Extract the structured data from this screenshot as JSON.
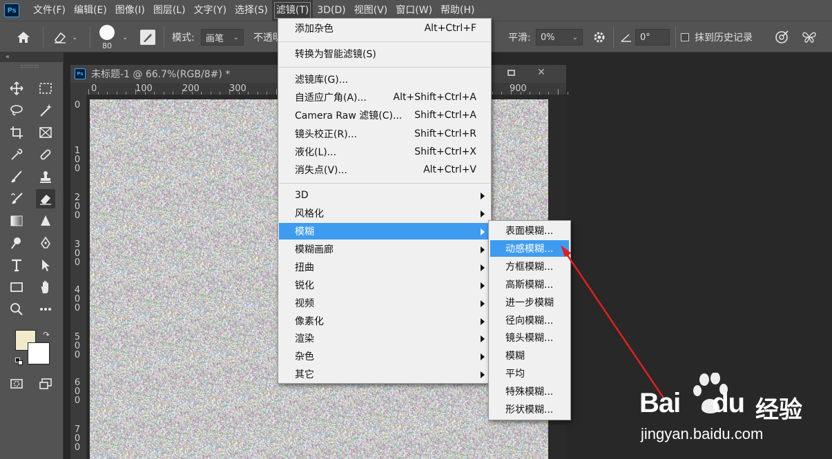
{
  "app": {
    "logo": "Ps"
  },
  "menubar": {
    "items": [
      "文件(F)",
      "编辑(E)",
      "图像(I)",
      "图层(L)",
      "文字(Y)",
      "选择(S)",
      "滤镜(T)",
      "3D(D)",
      "视图(V)",
      "窗口(W)",
      "帮助(H)"
    ],
    "active_index": 6
  },
  "options": {
    "brush_size": "80",
    "mode_label": "模式:",
    "mode_value": "画笔",
    "opacity_label": "不透明",
    "smooth_label": "平滑:",
    "smooth_value": "0%",
    "angle_value": "0°",
    "history_label": "抹到历史记录"
  },
  "document": {
    "title": "未标题-1 @ 66.7%(RGB/8#) *",
    "ruler_top": [
      "0",
      "100",
      "200",
      "300",
      "900"
    ],
    "ruler_left": [
      "0",
      "1\n0\n0",
      "2\n0\n0",
      "3\n0\n0",
      "4\n0\n0",
      "5\n0\n0",
      "6\n0\n0",
      "7\n0\n0"
    ],
    "canvas_texture": "noise"
  },
  "filter_menu": {
    "group1": [
      {
        "label": "添加杂色",
        "shortcut": "Alt+Ctrl+F"
      }
    ],
    "group2": [
      {
        "label": "转换为智能滤镜(S)",
        "shortcut": ""
      }
    ],
    "group3": [
      {
        "label": "滤镜库(G)...",
        "shortcut": ""
      },
      {
        "label": "自适应广角(A)...",
        "shortcut": "Alt+Shift+Ctrl+A"
      },
      {
        "label": "Camera Raw 滤镜(C)...",
        "shortcut": "Shift+Ctrl+A"
      },
      {
        "label": "镜头校正(R)...",
        "shortcut": "Shift+Ctrl+R"
      },
      {
        "label": "液化(L)...",
        "shortcut": "Shift+Ctrl+X"
      },
      {
        "label": "消失点(V)...",
        "shortcut": "Alt+Ctrl+V"
      }
    ],
    "group4": [
      {
        "label": "3D"
      },
      {
        "label": "风格化"
      },
      {
        "label": "模糊"
      },
      {
        "label": "模糊画廊"
      },
      {
        "label": "扭曲"
      },
      {
        "label": "锐化"
      },
      {
        "label": "视频"
      },
      {
        "label": "像素化"
      },
      {
        "label": "渲染"
      },
      {
        "label": "杂色"
      },
      {
        "label": "其它"
      }
    ],
    "highlighted": "模糊"
  },
  "blur_submenu": {
    "items": [
      "表面模糊...",
      "动感模糊...",
      "方框模糊...",
      "高斯模糊...",
      "进一步模糊",
      "径向模糊...",
      "镜头模糊...",
      "模糊",
      "平均",
      "特殊模糊...",
      "形状模糊..."
    ],
    "highlighted": "动感模糊..."
  },
  "colors": {
    "menu_highlight": "#3e9cf0",
    "foreground_swatch": "#f2ebcb",
    "background_swatch": "#ffffff",
    "annotation_arrow": "#e02020"
  },
  "watermark": {
    "brand": "Bai",
    "brand2": "du",
    "cn": "经验",
    "url": "jingyan.baidu.com"
  }
}
